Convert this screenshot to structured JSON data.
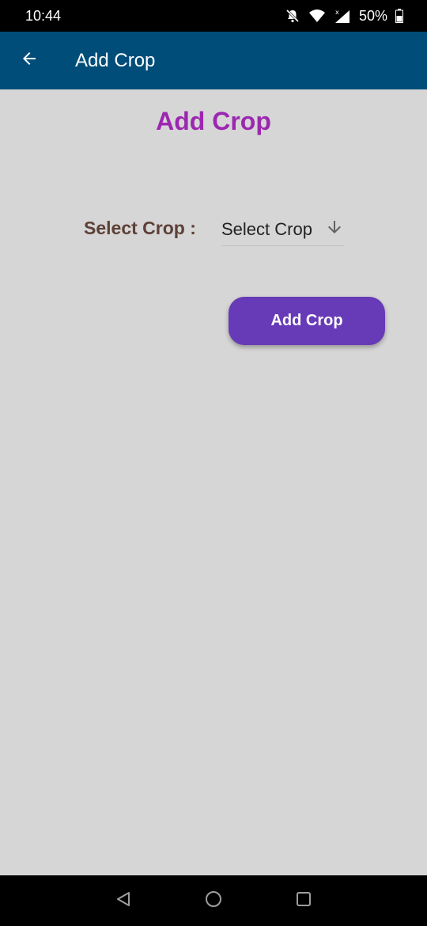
{
  "status_bar": {
    "time": "10:44",
    "battery": "50%",
    "icons": [
      "bell-off-icon",
      "wifi-icon",
      "signal-icon",
      "battery-icon"
    ]
  },
  "app_bar": {
    "title": "Add Crop",
    "back_icon": "arrow-back-icon",
    "background_color": "#004d79"
  },
  "main": {
    "heading": "Add Crop",
    "heading_color": "#9c27b0",
    "crop_label": "Select Crop :",
    "crop_select": {
      "value": "Select Crop",
      "icon": "arrow-down-icon"
    },
    "add_button_label": "Add Crop",
    "button_color": "#673ab7"
  },
  "nav_bar": {
    "buttons": [
      "back-triangle-icon",
      "home-circle-icon",
      "recents-square-icon"
    ]
  }
}
